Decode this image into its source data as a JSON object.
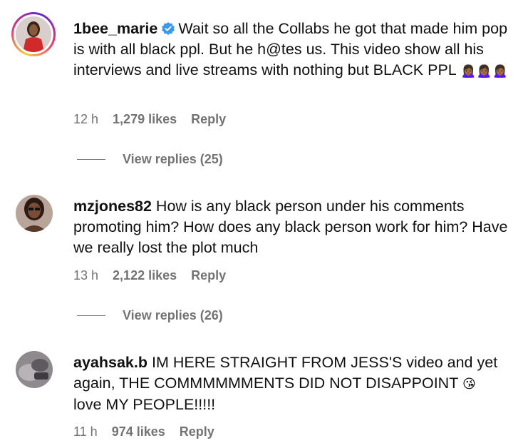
{
  "comments": [
    {
      "username": "1bee_marie",
      "text": "Wait so all the Collabs he got that made him pop is with all black ppl. But he h@tes us. This video show all his interviews and live streams with nothing but BLACK PPL",
      "emoji": "🙍🏾‍♀️🙍🏾‍♀️🙍🏾‍♀️",
      "time": "12 h",
      "likes": "1,279 likes",
      "reply_label": "Reply",
      "view_replies": "View replies (25)"
    },
    {
      "username": "mzjones82",
      "text": "How is any black person under his comments promoting him? How does any black person work for him? Have we really lost the plot much",
      "time": "13 h",
      "likes": "2,122 likes",
      "reply_label": "Reply",
      "view_replies": "View replies (26)"
    },
    {
      "username": "ayahsak.b",
      "text": "IM HERE STRAIGHT FROM JESS'S video and yet again, THE COMMMMMMENTS DID NOT DISAPPOINT",
      "emoji": "😘",
      "text_end": "love MY PEOPLE!!!!!",
      "time": "11 h",
      "likes": "974 likes",
      "reply_label": "Reply"
    }
  ]
}
